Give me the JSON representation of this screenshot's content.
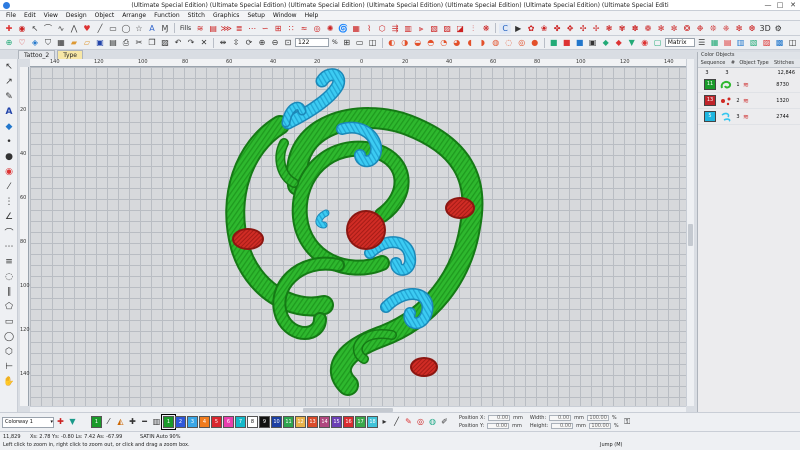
{
  "window": {
    "title": "(Ultimate Special Edition) (Ultimate Special Edition) (Ultimate Special Edition) (Ultimate Special Edition) (Ultimate Special Edition) (Ultimate Special Edition) (Ultimate Special Editi",
    "minimize": "—",
    "maximize": "□",
    "close": "✕"
  },
  "menu": [
    "File",
    "Edit",
    "View",
    "Design",
    "Object",
    "Arrange",
    "Function",
    "Stitch",
    "Graphics",
    "Setup",
    "Window",
    "Help"
  ],
  "toolbar": {
    "fills_label": "Fills",
    "zoom_value": "122",
    "zoom_unit": "%",
    "matrix_label": "Matrix",
    "view_3d": "3D"
  },
  "tabs": [
    {
      "label": "Tattoo_2",
      "active": false
    },
    {
      "label": "Type",
      "active": true
    }
  ],
  "rulers": {
    "top": [
      "140",
      "120",
      "100",
      "80",
      "60",
      "40",
      "20",
      "0",
      "20",
      "40",
      "60",
      "80",
      "100",
      "120",
      "140"
    ],
    "left": [
      "20",
      "40",
      "60",
      "80",
      "100",
      "120",
      "140"
    ]
  },
  "objects_panel": {
    "title": "Color Objects",
    "tab_labels": [
      "Sequence",
      "#",
      "Object Type",
      "Stitches"
    ],
    "summary": {
      "colors": "3",
      "objects": "3",
      "stitches": "12,846"
    },
    "rows": [
      {
        "chip_label": "11",
        "chip_color": "#1a9a2a",
        "index": "1",
        "stitches": "8730"
      },
      {
        "chip_label": "13",
        "chip_color": "#c0242a",
        "index": "2",
        "stitches": "1320"
      },
      {
        "chip_label": "5",
        "chip_color": "#1fb6e0",
        "index": "3",
        "stitches": "2744"
      }
    ]
  },
  "colorbar": {
    "palette": "Colorway 1",
    "swatches": [
      {
        "label": "1",
        "color": "#1a9a2a"
      },
      {
        "label": "1",
        "color": "#1a9a2a",
        "selected": true
      },
      {
        "label": "2",
        "color": "#2f57d8"
      },
      {
        "label": "3",
        "color": "#3aa6e6"
      },
      {
        "label": "4",
        "color": "#f07b1e"
      },
      {
        "label": "5",
        "color": "#d8262e"
      },
      {
        "label": "6",
        "color": "#e83fae"
      },
      {
        "label": "7",
        "color": "#15b8c9"
      },
      {
        "label": "8",
        "color": "#ffffff"
      },
      {
        "label": "9",
        "color": "#111111"
      },
      {
        "label": "10",
        "color": "#1c3fa3"
      },
      {
        "label": "11",
        "color": "#2ea44f"
      },
      {
        "label": "12",
        "color": "#e8b24a"
      },
      {
        "label": "13",
        "color": "#d94b2b"
      },
      {
        "label": "14",
        "color": "#b0477f"
      },
      {
        "label": "15",
        "color": "#6a3fb5"
      },
      {
        "label": "16",
        "color": "#d92c30"
      },
      {
        "label": "17",
        "color": "#39a84a"
      },
      {
        "label": "18",
        "color": "#40c3d8"
      }
    ],
    "position_x_label": "Position X:",
    "position_y_label": "Position Y:",
    "width_label": "Width:",
    "height_label": "Height:",
    "position_x": "0.00",
    "position_y": "0.00",
    "width": "0.00",
    "height": "0.00",
    "percent_w": "100.00",
    "percent_h": "100.00",
    "unit_mm": "mm",
    "unit_pct": "%"
  },
  "status": {
    "stitch_count": "11,829",
    "coords": "Xs: 2.78 Ys: -0.80 Ls: 7.42 As: -67.99",
    "mode": "SATIN Auto 90%",
    "hint": "Left click to zoom in, right click to zoom out, or click and drag a zoom box.",
    "jump": "Jump (M)"
  },
  "colors": {
    "green": "#2eb82e",
    "green_dark": "#157a15",
    "cyan": "#36c6ef",
    "cyan_dark": "#1b88b8",
    "red": "#cf2a24",
    "red_dark": "#8c1611"
  }
}
